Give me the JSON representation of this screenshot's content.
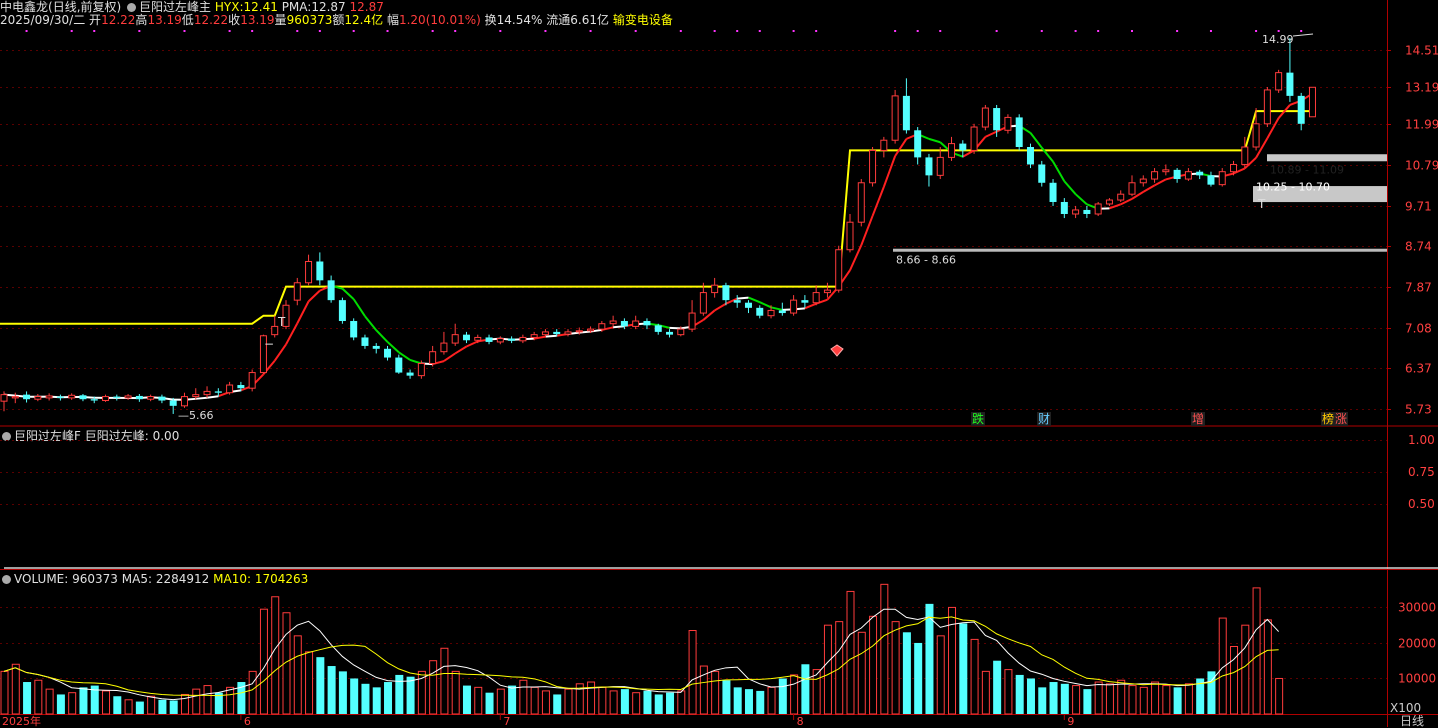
{
  "header": {
    "stock_name": "中电鑫龙",
    "period_mode": "(日线,前复权)",
    "indicator_name": "巨阳过左峰主",
    "hyx_label": "HYX:",
    "hyx_value": "12.41",
    "pma_label": "PMA:",
    "pma_value": "12.87",
    "extra_value": "12.87",
    "date": "2025/09/30/二",
    "open_label": "开",
    "open": "12.22",
    "high_label": "高",
    "high": "13.19",
    "low_label": "低",
    "low": "12.22",
    "close_label": "收",
    "close": "13.19",
    "vol_label": "量",
    "vol": "960373",
    "amt_label": "额",
    "amt": "12.4亿",
    "chg_label": "幅",
    "chg": "1.20(10.01%)",
    "turn_label": "换",
    "turn": "14.54%",
    "float_label": "流通",
    "float": "6.61亿",
    "industry": "输变电设备"
  },
  "sub1": {
    "title": "巨阳过左峰F",
    "label": "巨阳过左峰:",
    "value": "0.00"
  },
  "sub2": {
    "vol_label": "VOLUME:",
    "vol": "960373",
    "ma5_label": "MA5:",
    "ma5": "2284912",
    "ma10_label": "MA10:",
    "ma10": "1704263",
    "unit": "X100"
  },
  "footer": {
    "period": "日线"
  },
  "colors": {
    "up": "#ff3c3c",
    "down": "#54ffff",
    "ma_up": "#ff2020",
    "ma_flat": "#ffffff",
    "ma_down": "#00dd00",
    "level": "#ffff00",
    "grid": "#5a0000",
    "axis": "#b00000"
  },
  "chart_data": [
    {
      "type": "candlestick",
      "price_ticks": [
        "14.51",
        "13.19",
        "11.99",
        "10.79",
        "9.71",
        "8.74",
        "7.87",
        "7.08",
        "6.37",
        "5.73"
      ],
      "ylim": [
        5.5,
        15.3
      ],
      "log_scale": true,
      "x_ticks": [
        "2025年",
        "6",
        "7",
        "8",
        "9"
      ],
      "candles": [
        [
          5.85,
          5.95,
          5.7,
          6.0
        ],
        [
          5.9,
          5.92,
          5.82,
          5.98
        ],
        [
          5.95,
          5.88,
          5.83,
          6.0
        ],
        [
          5.88,
          5.92,
          5.85,
          5.96
        ],
        [
          5.9,
          5.93,
          5.86,
          5.97
        ],
        [
          5.92,
          5.9,
          5.86,
          5.95
        ],
        [
          5.9,
          5.94,
          5.87,
          5.97
        ],
        [
          5.94,
          5.88,
          5.85,
          5.96
        ],
        [
          5.88,
          5.86,
          5.82,
          5.92
        ],
        [
          5.86,
          5.92,
          5.84,
          5.95
        ],
        [
          5.92,
          5.9,
          5.86,
          5.95
        ],
        [
          5.9,
          5.93,
          5.87,
          5.96
        ],
        [
          5.93,
          5.88,
          5.84,
          5.96
        ],
        [
          5.88,
          5.92,
          5.85,
          5.95
        ],
        [
          5.92,
          5.86,
          5.82,
          5.95
        ],
        [
          5.86,
          5.78,
          5.66,
          5.9
        ],
        [
          5.78,
          5.92,
          5.75,
          5.98
        ],
        [
          5.92,
          5.95,
          5.88,
          6.05
        ],
        [
          5.95,
          6.0,
          5.9,
          6.08
        ],
        [
          6.0,
          5.98,
          5.92,
          6.05
        ],
        [
          5.98,
          6.1,
          5.95,
          6.15
        ],
        [
          6.1,
          6.05,
          6.0,
          6.15
        ],
        [
          6.05,
          6.3,
          6.0,
          6.35
        ],
        [
          6.3,
          6.93,
          6.28,
          6.95
        ],
        [
          6.95,
          7.1,
          6.9,
          7.3
        ],
        [
          7.1,
          7.5,
          7.05,
          7.6
        ],
        [
          7.6,
          7.95,
          7.5,
          8.05
        ],
        [
          7.95,
          8.4,
          7.9,
          8.55
        ],
        [
          8.4,
          8.0,
          7.9,
          8.6
        ],
        [
          8.0,
          7.6,
          7.55,
          8.1
        ],
        [
          7.6,
          7.2,
          7.15,
          7.65
        ],
        [
          7.2,
          6.9,
          6.85,
          7.25
        ],
        [
          6.9,
          6.75,
          6.7,
          6.95
        ],
        [
          6.75,
          6.7,
          6.62,
          6.8
        ],
        [
          6.7,
          6.55,
          6.5,
          6.75
        ],
        [
          6.55,
          6.3,
          6.28,
          6.6
        ],
        [
          6.3,
          6.25,
          6.2,
          6.35
        ],
        [
          6.25,
          6.45,
          6.2,
          6.5
        ],
        [
          6.45,
          6.65,
          6.4,
          6.75
        ],
        [
          6.65,
          6.8,
          6.6,
          7.0
        ],
        [
          6.8,
          6.95,
          6.75,
          7.15
        ],
        [
          6.95,
          6.85,
          6.8,
          7.0
        ],
        [
          6.85,
          6.9,
          6.8,
          6.95
        ],
        [
          6.9,
          6.82,
          6.78,
          6.95
        ],
        [
          6.82,
          6.88,
          6.78,
          6.92
        ],
        [
          6.88,
          6.84,
          6.8,
          6.92
        ],
        [
          6.84,
          6.9,
          6.8,
          6.95
        ],
        [
          6.9,
          6.95,
          6.85,
          7.0
        ],
        [
          6.95,
          7.0,
          6.9,
          7.05
        ],
        [
          7.0,
          6.96,
          6.92,
          7.05
        ],
        [
          6.96,
          7.0,
          6.92,
          7.05
        ],
        [
          7.0,
          7.02,
          6.95,
          7.08
        ],
        [
          7.02,
          7.05,
          6.98,
          7.1
        ],
        [
          7.05,
          7.15,
          7.0,
          7.2
        ],
        [
          7.15,
          7.2,
          7.1,
          7.3
        ],
        [
          7.2,
          7.1,
          7.05,
          7.25
        ],
        [
          7.1,
          7.2,
          7.05,
          7.3
        ],
        [
          7.2,
          7.12,
          7.05,
          7.25
        ],
        [
          7.12,
          7.0,
          6.95,
          7.15
        ],
        [
          7.0,
          6.95,
          6.9,
          7.05
        ],
        [
          6.95,
          7.05,
          6.92,
          7.1
        ],
        [
          7.05,
          7.35,
          7.0,
          7.6
        ],
        [
          7.35,
          7.75,
          7.3,
          7.95
        ],
        [
          7.75,
          7.9,
          7.65,
          8.05
        ],
        [
          7.9,
          7.6,
          7.5,
          7.95
        ],
        [
          7.6,
          7.55,
          7.45,
          7.7
        ],
        [
          7.55,
          7.45,
          7.35,
          7.6
        ],
        [
          7.45,
          7.3,
          7.25,
          7.5
        ],
        [
          7.3,
          7.4,
          7.25,
          7.5
        ],
        [
          7.4,
          7.35,
          7.3,
          7.55
        ],
        [
          7.35,
          7.6,
          7.3,
          7.7
        ],
        [
          7.6,
          7.55,
          7.45,
          7.7
        ],
        [
          7.55,
          7.75,
          7.5,
          7.9
        ],
        [
          7.75,
          7.8,
          7.65,
          7.95
        ],
        [
          7.8,
          8.66,
          7.75,
          8.75
        ],
        [
          8.66,
          9.3,
          8.6,
          9.5
        ],
        [
          9.3,
          10.3,
          9.2,
          10.4
        ],
        [
          10.3,
          11.2,
          10.2,
          11.3
        ],
        [
          11.2,
          11.5,
          11.0,
          11.6
        ],
        [
          11.5,
          12.9,
          11.4,
          13.1
        ],
        [
          12.9,
          11.8,
          11.7,
          13.5
        ],
        [
          11.8,
          11.0,
          10.8,
          11.9
        ],
        [
          11.0,
          10.5,
          10.2,
          11.1
        ],
        [
          10.5,
          11.0,
          10.4,
          11.3
        ],
        [
          11.0,
          11.4,
          10.9,
          11.6
        ],
        [
          11.4,
          11.2,
          11.0,
          11.5
        ],
        [
          11.2,
          11.9,
          11.1,
          12.0
        ],
        [
          11.9,
          12.5,
          11.8,
          12.6
        ],
        [
          12.5,
          11.8,
          11.6,
          12.6
        ],
        [
          11.8,
          12.2,
          11.7,
          12.3
        ],
        [
          12.2,
          11.3,
          11.2,
          12.3
        ],
        [
          11.3,
          10.8,
          10.7,
          11.4
        ],
        [
          10.8,
          10.3,
          10.2,
          10.9
        ],
        [
          10.3,
          9.8,
          9.7,
          10.4
        ],
        [
          9.8,
          9.5,
          9.4,
          9.9
        ],
        [
          9.5,
          9.6,
          9.4,
          9.7
        ],
        [
          9.6,
          9.5,
          9.4,
          9.7
        ],
        [
          9.5,
          9.75,
          9.45,
          9.8
        ],
        [
          9.75,
          9.85,
          9.7,
          9.9
        ],
        [
          9.85,
          10.0,
          9.8,
          10.1
        ],
        [
          10.0,
          10.3,
          9.95,
          10.5
        ],
        [
          10.3,
          10.4,
          10.2,
          10.5
        ],
        [
          10.4,
          10.6,
          10.3,
          10.7
        ],
        [
          10.6,
          10.65,
          10.5,
          10.8
        ],
        [
          10.65,
          10.4,
          10.3,
          10.7
        ],
        [
          10.4,
          10.6,
          10.35,
          10.7
        ],
        [
          10.6,
          10.5,
          10.4,
          10.65
        ],
        [
          10.5,
          10.25,
          10.2,
          10.6
        ],
        [
          10.25,
          10.6,
          10.2,
          10.7
        ],
        [
          10.6,
          10.8,
          10.5,
          10.9
        ],
        [
          10.8,
          11.3,
          10.7,
          11.6
        ],
        [
          11.3,
          12.0,
          11.2,
          12.5
        ],
        [
          12.0,
          13.1,
          11.9,
          13.2
        ],
        [
          13.1,
          13.7,
          13.0,
          13.8
        ],
        [
          13.7,
          12.9,
          12.7,
          14.99
        ],
        [
          12.9,
          12.0,
          11.8,
          13.0
        ],
        [
          12.22,
          13.19,
          12.22,
          13.19
        ]
      ],
      "volumes_x100": [
        12000,
        14000,
        9000,
        9500,
        7000,
        5500,
        6000,
        7500,
        8000,
        6500,
        5000,
        4000,
        3500,
        5000,
        4000,
        3800,
        5500,
        7000,
        8000,
        6000,
        7500,
        9000,
        12000,
        29500,
        33000,
        28500,
        22000,
        17500,
        16000,
        13500,
        12000,
        10000,
        8500,
        7500,
        9000,
        11000,
        10500,
        12000,
        15000,
        18500,
        12000,
        8000,
        7500,
        6000,
        7000,
        8000,
        9500,
        7500,
        6500,
        5500,
        7000,
        8500,
        9000,
        7500,
        6500,
        7000,
        6000,
        6500,
        5500,
        6000,
        6500,
        23500,
        13500,
        12000,
        9500,
        7500,
        7000,
        6500,
        7500,
        10000,
        11000,
        14000,
        12500,
        25000,
        26000,
        34500,
        23000,
        27500,
        36500,
        26000,
        23000,
        20000,
        31000,
        22000,
        30000,
        25500,
        21000,
        12000,
        15000,
        12500,
        11000,
        10000,
        7500,
        9000,
        8500,
        8000,
        7000,
        9000,
        8500,
        9500,
        8000,
        7500,
        9000,
        8000,
        7500,
        8500,
        10000,
        12000,
        27000,
        19000,
        25000,
        35500,
        26500,
        10000
      ],
      "y_ticks": [
        "30000",
        "20000",
        "10000"
      ],
      "overlays": {
        "low_label": "5.66",
        "ranges": [
          {
            "label": "8.66 - 8.66",
            "value": 8.66
          },
          {
            "label": "10.89 - 11.09",
            "low": 10.89,
            "high": 11.09
          },
          {
            "label": "10.25 - 10.70",
            "low": 10.25,
            "high": 10.7
          }
        ],
        "peak_label": "14.99",
        "signals": [
          "跌",
          "财",
          "增",
          "榜",
          "涨"
        ],
        "markers": [
          "T",
          "T",
          "−"
        ]
      }
    },
    {
      "type": "line",
      "name": "巨阳过左峰",
      "y_ticks": [
        "1.00",
        "0.75",
        "0.50"
      ],
      "ylim": [
        0,
        1
      ],
      "values": [
        0,
        0,
        0,
        0,
        0,
        0,
        0,
        0,
        0,
        0,
        0,
        0,
        0,
        0,
        0,
        0,
        0,
        0,
        0,
        0,
        0,
        0,
        0,
        0,
        0,
        0,
        0,
        0,
        0,
        0,
        0,
        0,
        0,
        0,
        0,
        0,
        0,
        0,
        0,
        0,
        0,
        0,
        0,
        0,
        0,
        0,
        0,
        0,
        0,
        0,
        0,
        0,
        0,
        0,
        0,
        0,
        0,
        0,
        0,
        0,
        0,
        0,
        0,
        0,
        0,
        0,
        0,
        0,
        0,
        0,
        0,
        0,
        0,
        0,
        0,
        0,
        0,
        0,
        0,
        0,
        0,
        0,
        0,
        0,
        0,
        0,
        0,
        0,
        0,
        0,
        0,
        0,
        0,
        0,
        0,
        0,
        0,
        0,
        0,
        0,
        0,
        0,
        0,
        0,
        0,
        0,
        0,
        0,
        0,
        0,
        0,
        0,
        0,
        0,
        0,
        0,
        0,
        0,
        0,
        0,
        0,
        0,
        0,
        0,
        0,
        0,
        0,
        0,
        0,
        0
      ]
    }
  ]
}
